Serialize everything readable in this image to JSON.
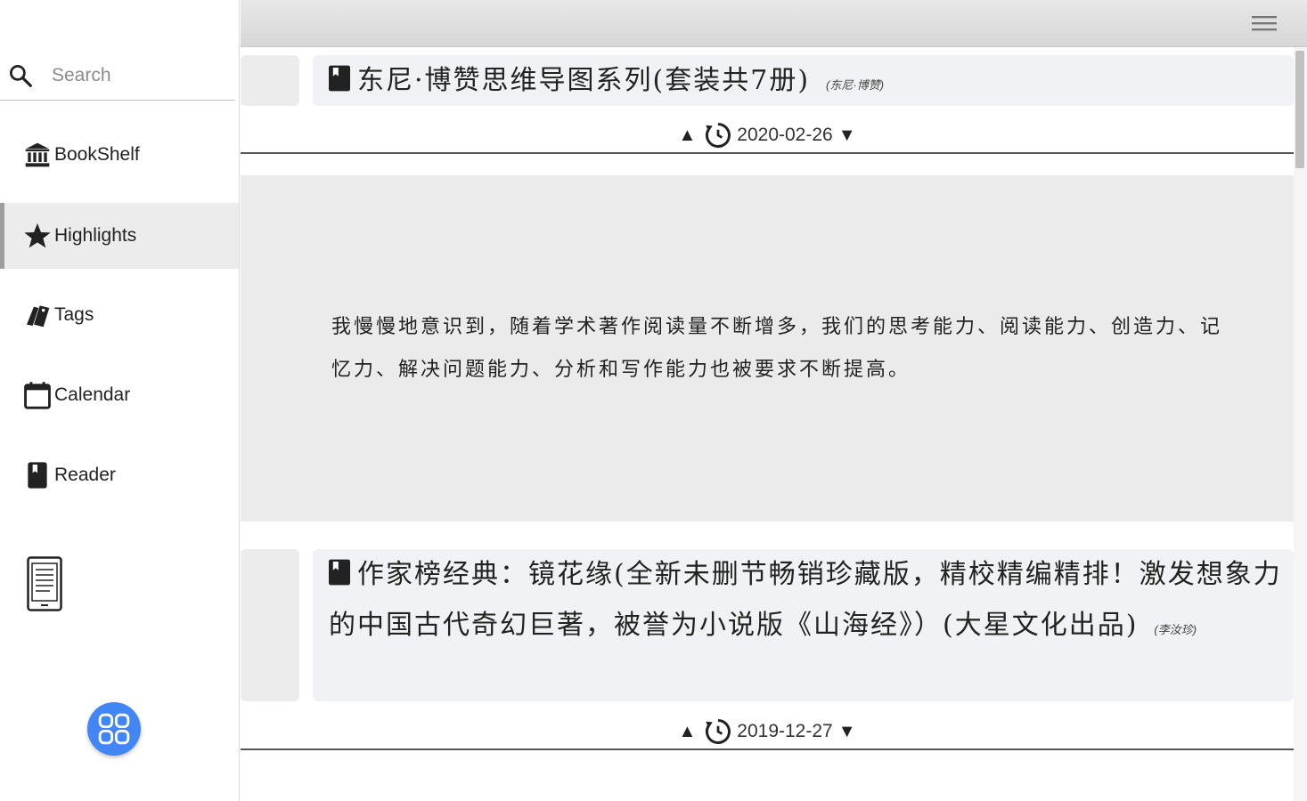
{
  "search": {
    "placeholder": "Search"
  },
  "sidebar": {
    "items": [
      {
        "label": "BookShelf",
        "icon": "bank-icon"
      },
      {
        "label": "Highlights",
        "icon": "star-icon"
      },
      {
        "label": "Tags",
        "icon": "tags-icon"
      },
      {
        "label": "Calendar",
        "icon": "calendar-icon"
      },
      {
        "label": "Reader",
        "icon": "book-icon"
      }
    ],
    "device_icon": "ereader-icon",
    "fab_icon": "grid-icon"
  },
  "topbar": {
    "menu_icon": "hamburger-menu-icon"
  },
  "entries": [
    {
      "title": "东尼·博赞思维导图系列(套装共7册)",
      "author": "(东尼·博赞)",
      "up_arrow": "▲",
      "down_arrow": "▼",
      "date": "2020-02-26",
      "highlight": "我慢慢地意识到，随着学术著作阅读量不断增多，我们的思考能力、阅读能力、创造力、记忆力、解决问题能力、分析和写作能力也被要求不断提高。"
    },
    {
      "title": "作家榜经典：镜花缘(全新未删节畅销珍藏版，精校精编精排！激发想象力的中国古代奇幻巨著，被誉为小说版《山海经》）(大星文化出品)",
      "author": "(李汝珍)",
      "up_arrow": "▲",
      "down_arrow": "▼",
      "date": "2019-12-27"
    }
  ],
  "colors": {
    "fab": "#4285f4",
    "active_bg": "#ececec",
    "card_bg": "#f1f2f5",
    "highlight_bg": "#ebebeb"
  }
}
